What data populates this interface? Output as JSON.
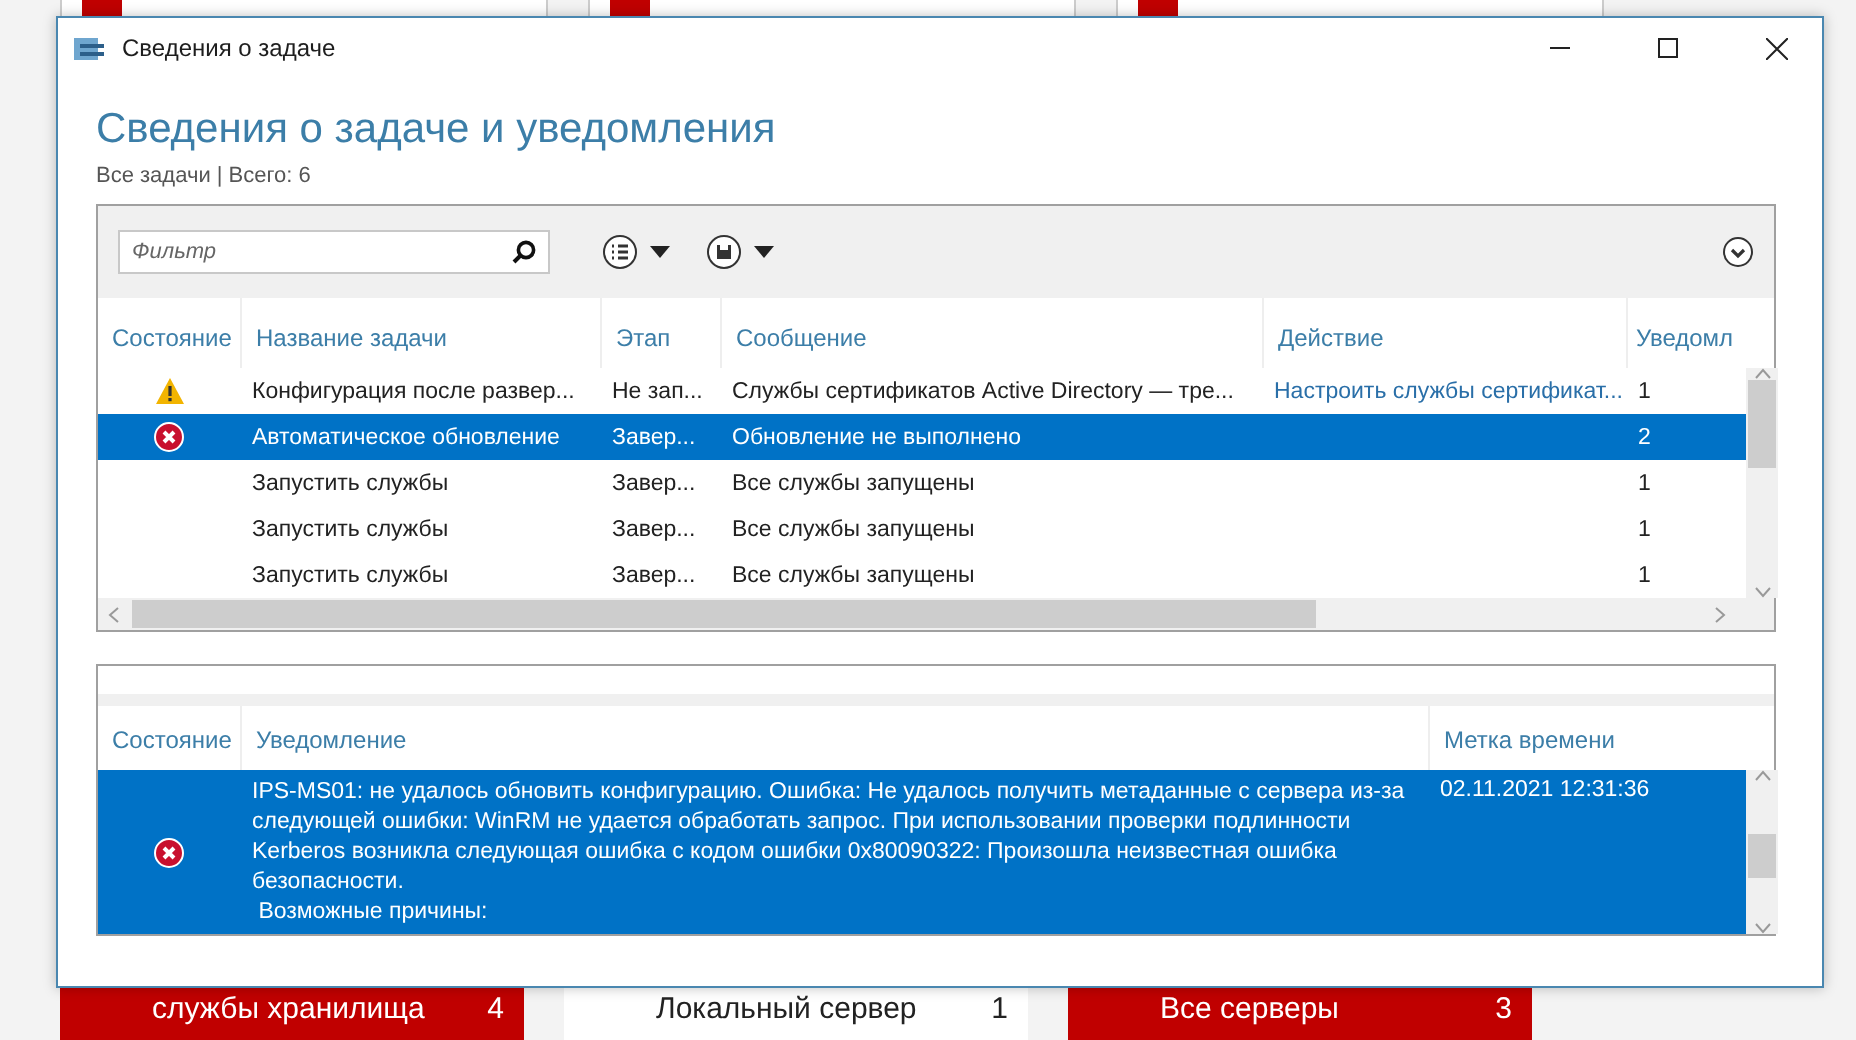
{
  "background": {
    "bottom_tiles": [
      {
        "label": "службы хранилища",
        "count": "4",
        "kind": "alert"
      },
      {
        "label": "Локальный сервер",
        "count": "1",
        "kind": "normal"
      },
      {
        "label": "Все серверы",
        "count": "3",
        "kind": "alert"
      }
    ]
  },
  "window": {
    "title": "Сведения о задаче"
  },
  "heading": "Сведения о задаче и уведомления",
  "subtitle": "Все задачи | Всего: 6",
  "filter": {
    "placeholder": "Фильтр"
  },
  "tasks": {
    "columns": [
      "Состояние",
      "Название задачи",
      "Этап",
      "Сообщение",
      "Действие",
      "Уведомл"
    ],
    "rows": [
      {
        "kind": "warning",
        "name": "Конфигурация после развер...",
        "stage": "Не зап...",
        "message": "Службы сертификатов Active Directory — тре...",
        "action": "Настроить службы сертификат...",
        "count": "1",
        "selected": false
      },
      {
        "kind": "error",
        "name": "Автоматическое обновление",
        "stage": "Завер...",
        "message": "Обновление не выполнено",
        "count": "2",
        "selected": true
      },
      {
        "kind": "plain",
        "name": "Запустить службы",
        "stage": "Завер...",
        "message": "Все службы запущены",
        "count": "1",
        "selected": false
      },
      {
        "kind": "plain",
        "name": "Запустить службы",
        "stage": "Завер...",
        "message": "Все службы запущены",
        "count": "1",
        "selected": false
      },
      {
        "kind": "plain",
        "name": "Запустить службы",
        "stage": "Завер...",
        "message": "Все службы запущены",
        "count": "1",
        "selected": false
      }
    ]
  },
  "notifications": {
    "columns": [
      "Состояние",
      "Уведомление",
      "Метка времени"
    ],
    "rows": [
      {
        "kind": "error",
        "message": "IPS-MS01: не удалось обновить конфигурацию. Ошибка: Не удалось получить метаданные с сервера из-за следующей ошибки: WinRM не удается обработать запрос. При использовании проверки подлинности Kerberos возникла следующая ошибка с кодом ошибки 0x80090322: Произошла неизвестная ошибка безопасности.",
        "continuation": "Возможные причины:",
        "time": "02.11.2021 12:31:36",
        "selected": true
      }
    ]
  }
}
